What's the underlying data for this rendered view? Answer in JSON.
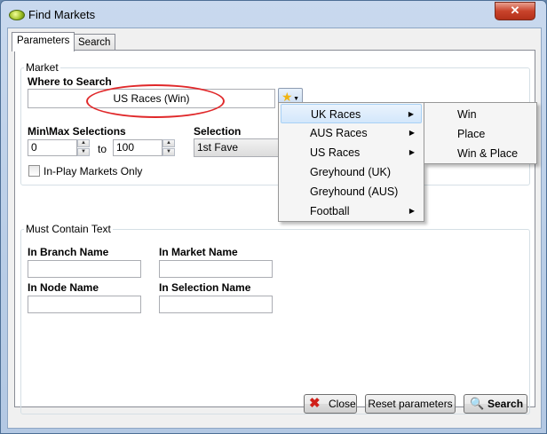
{
  "window": {
    "title": "Find Markets",
    "close_glyph": "✕"
  },
  "tabs": [
    {
      "label": "Parameters",
      "active": true
    },
    {
      "label": "Search",
      "active": false
    }
  ],
  "market": {
    "group_label": "Market",
    "where_label": "Where to Search",
    "where_value": "US Races (Win)",
    "minmax_label": "Min\\Max Selections",
    "min_value": "0",
    "to_label": "to",
    "max_value": "100",
    "selection_label": "Selection",
    "selection_value": "1st Fave",
    "inplay_label": "In-Play Markets Only",
    "inplay_checked": false
  },
  "must_contain": {
    "group_label": "Must Contain Text",
    "branch_label": "In Branch Name",
    "market_label": "In Market Name",
    "node_label": "In Node Name",
    "selection_label": "In Selection Name",
    "branch_value": "",
    "market_value": "",
    "node_value": "",
    "selection_value": ""
  },
  "menu": {
    "items": [
      {
        "label": "UK Races",
        "submenu": true,
        "highlighted": true
      },
      {
        "label": "AUS Races",
        "submenu": true,
        "highlighted": false
      },
      {
        "label": "US Races",
        "submenu": true,
        "highlighted": false
      },
      {
        "label": "Greyhound (UK)",
        "submenu": false,
        "highlighted": false
      },
      {
        "label": "Greyhound (AUS)",
        "submenu": false,
        "highlighted": false
      },
      {
        "label": "Football",
        "submenu": true,
        "highlighted": false
      }
    ],
    "submenu_items": [
      "Win",
      "Place",
      "Win & Place"
    ],
    "submenu_arrow": "▶"
  },
  "buttons": {
    "close_label": "Close",
    "reset_label": "Reset parameters",
    "search_label": "Search"
  },
  "icons": {
    "close_button_icon": "red-x-icon",
    "search_button_icon": "magnifier-icon",
    "favorites_icon": "star-icon"
  },
  "colors": {
    "highlight_oval": "#e0282a",
    "menu_highlight": "#d3e7fb",
    "titlebar_close": "#c9432b"
  }
}
